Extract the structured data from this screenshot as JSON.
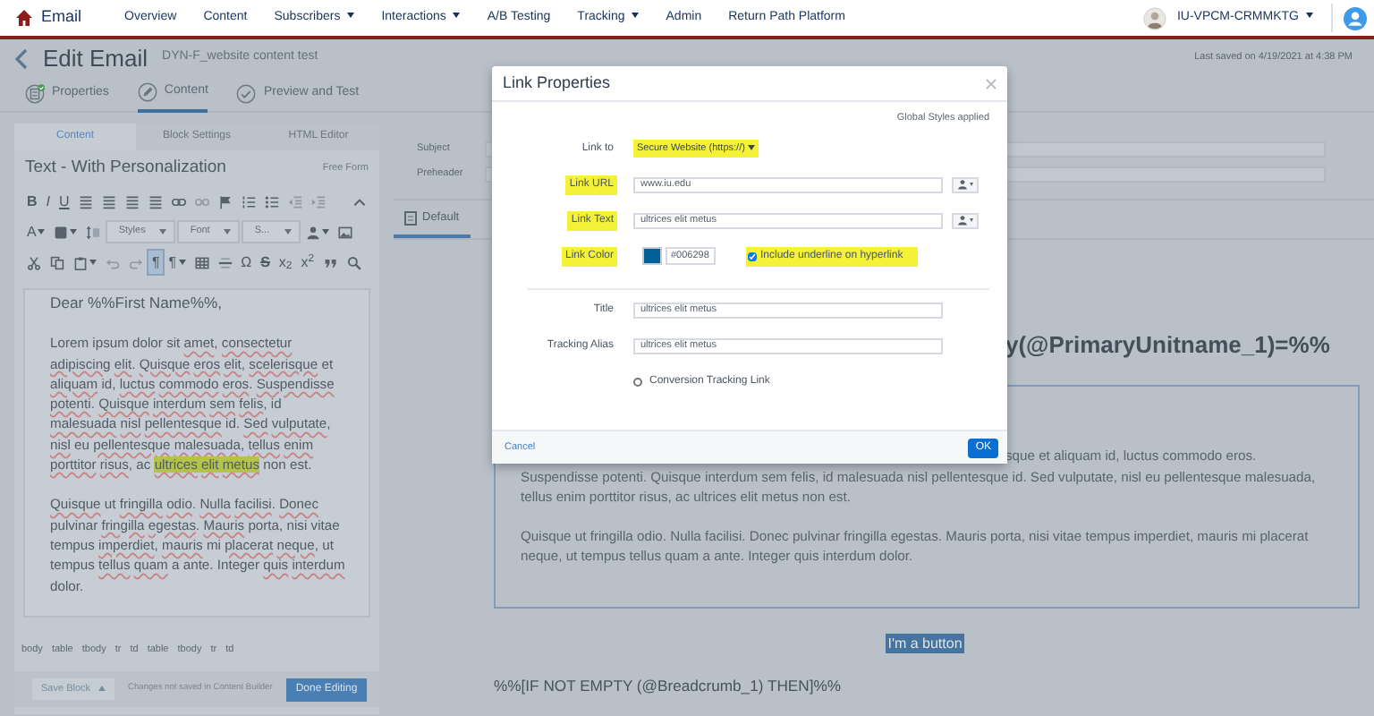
{
  "nav": {
    "app": "Email",
    "items": [
      {
        "label": "Overview",
        "dropdown": false
      },
      {
        "label": "Content",
        "dropdown": false
      },
      {
        "label": "Subscribers",
        "dropdown": true
      },
      {
        "label": "Interactions",
        "dropdown": true
      },
      {
        "label": "A/B Testing",
        "dropdown": false
      },
      {
        "label": "Tracking",
        "dropdown": true
      },
      {
        "label": "Admin",
        "dropdown": false
      },
      {
        "label": "Return Path Platform",
        "dropdown": false
      }
    ],
    "account": "IU-VPCM-CRMMKTG"
  },
  "header": {
    "title": "Edit Email",
    "email_name": "DYN-F_website content test",
    "last_saved": "Last saved on 4/19/2021 at 4:38 PM"
  },
  "steps": [
    {
      "label": "Properties",
      "kind": "document",
      "done": true,
      "selected": false
    },
    {
      "label": "Content",
      "kind": "pencil",
      "done": false,
      "selected": true
    },
    {
      "label": "Preview and Test",
      "kind": "check",
      "done": false,
      "selected": false
    }
  ],
  "editor": {
    "tabs": [
      {
        "label": "Content",
        "selected": true
      },
      {
        "label": "Block Settings",
        "selected": false
      },
      {
        "label": "HTML Editor",
        "selected": false
      }
    ],
    "block_title": "Text - With Personalization",
    "mode": "Free Form",
    "toolbar": [
      [
        {
          "kind": "bold",
          "label": "B",
          "active": false,
          "disabled": false,
          "menu": false
        },
        {
          "kind": "italic",
          "label": "I",
          "active": false,
          "disabled": false,
          "menu": false
        },
        {
          "kind": "underline",
          "label": "U",
          "active": false,
          "disabled": false,
          "menu": false
        },
        {
          "kind": "align",
          "active": false,
          "disabled": false,
          "menu": false
        },
        {
          "kind": "align",
          "active": false,
          "disabled": false,
          "menu": false
        },
        {
          "kind": "align",
          "active": false,
          "disabled": false,
          "menu": false
        },
        {
          "kind": "align",
          "active": false,
          "disabled": false,
          "menu": false
        },
        {
          "kind": "link",
          "active": false,
          "disabled": false,
          "menu": false
        },
        {
          "kind": "unlink",
          "active": false,
          "disabled": true,
          "menu": false
        },
        {
          "kind": "flag",
          "active": false,
          "disabled": false,
          "menu": false
        },
        {
          "kind": "numlist",
          "active": false,
          "disabled": false,
          "menu": false
        },
        {
          "kind": "bullist",
          "active": false,
          "disabled": false,
          "menu": false
        },
        {
          "kind": "outdent",
          "active": false,
          "disabled": true,
          "menu": false
        },
        {
          "kind": "indent",
          "active": false,
          "disabled": true,
          "menu": false
        },
        {
          "kind": "collapse",
          "active": false,
          "disabled": false,
          "menu": false
        }
      ],
      [
        {
          "kind": "text",
          "label": "A",
          "active": false,
          "disabled": false,
          "menu": true
        },
        {
          "kind": "fill",
          "active": false,
          "disabled": false,
          "menu": true
        },
        {
          "kind": "lineheight",
          "active": false,
          "disabled": false,
          "menu": false
        },
        {
          "kind": "dropdown",
          "label": "Styles",
          "active": false,
          "disabled": false,
          "menu": true
        },
        {
          "kind": "dropdown",
          "label": "Font",
          "active": false,
          "disabled": false,
          "menu": true
        },
        {
          "kind": "dropdown",
          "label": "S...",
          "active": false,
          "disabled": false,
          "menu": true
        },
        {
          "kind": "person",
          "active": false,
          "disabled": false,
          "menu": true
        },
        {
          "kind": "image",
          "active": false,
          "disabled": false,
          "menu": false
        }
      ],
      [
        {
          "kind": "cut",
          "active": false,
          "disabled": false,
          "menu": false
        },
        {
          "kind": "copy",
          "active": false,
          "disabled": false,
          "menu": false
        },
        {
          "kind": "paste",
          "active": false,
          "disabled": false,
          "menu": true
        },
        {
          "kind": "undo",
          "active": false,
          "disabled": true,
          "menu": false
        },
        {
          "kind": "redo",
          "active": false,
          "disabled": true,
          "menu": false
        },
        {
          "kind": "text",
          "label": "¶",
          "active": true,
          "disabled": false,
          "menu": false
        },
        {
          "kind": "text",
          "label": "¶",
          "active": false,
          "disabled": false,
          "menu": true
        },
        {
          "kind": "table",
          "active": false,
          "disabled": false,
          "menu": false
        },
        {
          "kind": "hr",
          "active": false,
          "disabled": false,
          "menu": false
        },
        {
          "kind": "text",
          "label": "Ω",
          "active": false,
          "disabled": false,
          "menu": false
        },
        {
          "kind": "strike",
          "label": "S",
          "active": false,
          "disabled": false,
          "menu": false
        },
        {
          "kind": "text",
          "label": "x$_{2}$",
          "active": false,
          "disabled": false,
          "menu": false
        },
        {
          "kind": "text",
          "label": "x$^{2}$",
          "active": false,
          "disabled": false,
          "menu": false
        },
        {
          "kind": "quote",
          "active": false,
          "disabled": false,
          "menu": false
        },
        {
          "kind": "search",
          "active": false,
          "disabled": false,
          "menu": false
        }
      ]
    ],
    "greeting": "Dear %%First Name%%,",
    "paragraphs": [
      [
        {
          "text": "Lorem ipsum dolor sit ",
          "misspelled": false,
          "highlighted": false
        },
        {
          "text": "amet, consectetur adipiscing elit. Quisque eros elit, scelerisque ",
          "misspelled": true,
          "highlighted": false
        },
        {
          "text": "et ",
          "misspelled": false,
          "highlighted": false
        },
        {
          "text": "aliquam ",
          "misspelled": true,
          "highlighted": false
        },
        {
          "text": "id, ",
          "misspelled": false,
          "highlighted": false
        },
        {
          "text": "luctus commodo eros. Suspendisse potenti. Quisque interdum sem felis, ",
          "misspelled": true,
          "highlighted": false
        },
        {
          "text": "id ",
          "misspelled": false,
          "highlighted": false
        },
        {
          "text": "malesuada nisl pellentesque ",
          "misspelled": true,
          "highlighted": false
        },
        {
          "text": "id. ",
          "misspelled": false,
          "highlighted": false
        },
        {
          "text": "Sed vulputate, nisl ",
          "misspelled": true,
          "highlighted": false
        },
        {
          "text": "eu ",
          "misspelled": false,
          "highlighted": false
        },
        {
          "text": "pellentesque malesuada, tellus enim porttitor risus, ",
          "misspelled": true,
          "highlighted": false
        },
        {
          "text": "ac ",
          "misspelled": false,
          "highlighted": false
        },
        {
          "text": "ultrices elit metus",
          "misspelled": true,
          "highlighted": true
        },
        {
          "text": " non est.",
          "misspelled": false,
          "highlighted": false
        }
      ],
      [
        {
          "text": "Quisque ",
          "misspelled": true,
          "highlighted": false
        },
        {
          "text": "ut ",
          "misspelled": false,
          "highlighted": false
        },
        {
          "text": "fringilla odio. Nulla facilisi. Donec ",
          "misspelled": true,
          "highlighted": false
        },
        {
          "text": "pulvinar ",
          "misspelled": false,
          "highlighted": false
        },
        {
          "text": "fringilla egestas. Mauris ",
          "misspelled": true,
          "highlighted": false
        },
        {
          "text": "porta, nisi vitae tempus ",
          "misspelled": false,
          "highlighted": false
        },
        {
          "text": "imperdiet, mauris ",
          "misspelled": true,
          "highlighted": false
        },
        {
          "text": "mi ",
          "misspelled": false,
          "highlighted": false
        },
        {
          "text": "placerat neque, ",
          "misspelled": true,
          "highlighted": false
        },
        {
          "text": "ut tempus ",
          "misspelled": false,
          "highlighted": false
        },
        {
          "text": "tellus quam ",
          "misspelled": true,
          "highlighted": false
        },
        {
          "text": "a ante. Integer ",
          "misspelled": false,
          "highlighted": false
        },
        {
          "text": "quis interdum ",
          "misspelled": true,
          "highlighted": false
        },
        {
          "text": "dolor.",
          "misspelled": false,
          "highlighted": false
        }
      ]
    ],
    "breadcrumbs": [
      "body",
      "table",
      "tbody",
      "tr",
      "td",
      "table",
      "tbody",
      "tr",
      "td"
    ],
    "save_button": "Save Block",
    "status": "Changes not saved in Content Builder",
    "done_button": "Done Editing"
  },
  "email": {
    "fields": [
      {
        "label": "Subject"
      },
      {
        "label": "Preheader"
      }
    ],
    "tabs": [
      {
        "label": "Default",
        "selected": true
      }
    ],
    "preview": {
      "heading": "y(@PrimaryUnitname_1)=%%",
      "first_line": "sque et aliquam id, luctus commodo eros.",
      "paragraphs": [
        "Suspendisse potenti. Quisque interdum sem felis, id malesuada nisl pellentesque id. Sed vulputate, nisl eu pellentesque malesuada, tellus enim porttitor risus, ac ultrices elit metus non est.",
        "Quisque ut fringilla odio. Nulla facilisi. Donec pulvinar fringilla egestas. Mauris porta, nisi vitae tempus imperdiet, mauris mi placerat neque, ut tempus tellus quam a ante. Integer quis interdum dolor."
      ],
      "button": "I'm a button",
      "condition": "%%[IF NOT EMPTY (@Breadcrumb_1) THEN]%%"
    }
  },
  "modal": {
    "title": "Link Properties",
    "note": "Global Styles applied",
    "sections": [
      [
        {
          "kind": "select",
          "label": "Link to",
          "label_highlighted": false,
          "value": "Secure Website (https://)",
          "value_highlighted": true
        },
        {
          "kind": "input",
          "label": "Link URL",
          "label_highlighted": true,
          "value": "www.iu.edu",
          "picker": true
        },
        {
          "kind": "input",
          "label": "Link Text",
          "label_highlighted": true,
          "value": "ultrices elit metus",
          "picker": true
        },
        {
          "kind": "color",
          "label": "Link Color",
          "label_highlighted": true,
          "value": "#006298",
          "option": {
            "label": "Include underline on hyperlink",
            "checked": true,
            "highlighted": true
          }
        }
      ],
      [
        {
          "kind": "input",
          "label": "Title",
          "label_highlighted": false,
          "value": "ultrices elit metus",
          "picker": false
        },
        {
          "kind": "input",
          "label": "Tracking Alias",
          "label_highlighted": false,
          "value": "ultrices elit metus",
          "picker": false
        },
        {
          "kind": "checkbox",
          "label": "Conversion Tracking Link",
          "checked": false
        }
      ]
    ],
    "cancel": "Cancel",
    "ok": "OK"
  }
}
